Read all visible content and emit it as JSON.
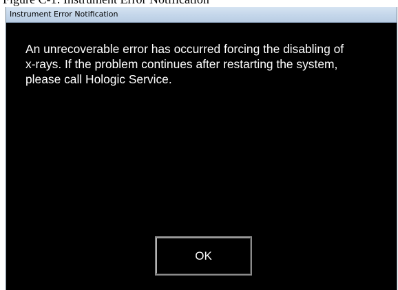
{
  "document": {
    "caption": "Figure C-1: Instrument Error Notification"
  },
  "dialog": {
    "title": "Instrument Error Notification",
    "message": "An unrecoverable error has occurred forcing the disabling of\nx-rays.  If the problem continues after restarting the system,\nplease call Hologic Service.",
    "ok_label": "OK"
  }
}
